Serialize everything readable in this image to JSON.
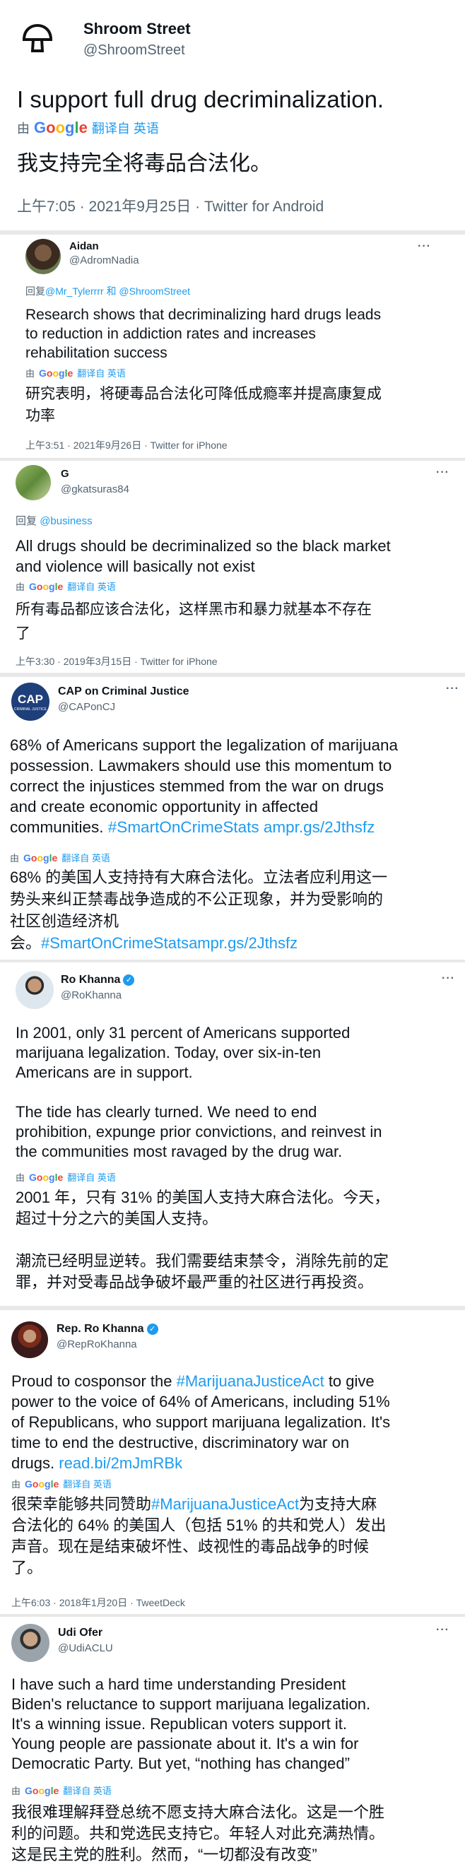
{
  "google": {
    "g1": "G",
    "o1": "o",
    "o2": "o",
    "g2": "g",
    "l": "l",
    "e": "e"
  },
  "t1": {
    "name": "Shroom Street",
    "handle": "@ShroomStreet",
    "text": "I support full drug decriminalization.",
    "trans_prefix": "由",
    "trans_link": "翻译自 英语",
    "zh": "我支持完全将毒品合法化。",
    "meta": "上午7:05 · 2021年9月25日 · Twitter for Android"
  },
  "t2": {
    "name": "Aidan",
    "handle": "@AdromNadia",
    "reply_prefix": "回复",
    "reply_links": "@Mr_Tylerrrr 和 @ShroomStreet",
    "text": "Research shows that decriminalizing hard drugs leads\nto reduction in addiction rates and increases\nrehabilitation success",
    "trans_prefix": "由",
    "trans_link": "翻译自 英语",
    "zh": "研究表明，将硬毒品合法化可降低成瘾率并提高康复成\n功率",
    "meta": "上午3:51 · 2021年9月26日 · Twitter for iPhone"
  },
  "t3": {
    "name": "G",
    "handle": "@gkatsuras84",
    "reply_prefix": "回复",
    "reply_links": "@business",
    "text": "All drugs should be decriminalized so the black market\nand violence will basically not exist",
    "trans_prefix": "由",
    "trans_link": "翻译自 英语",
    "zh": "所有毒品都应该合法化，这样黑市和暴力就基本不存在\n了",
    "meta": "上午3:30 · 2019年3月15日 · Twitter for iPhone"
  },
  "t4": {
    "name": "CAP on Criminal Justice",
    "handle": "@CAPonCJ",
    "avatar_text": "CAP",
    "avatar_sub": "CRIMINAL JUSTICE",
    "text": "68% of Americans support the legalization of marijuana\npossession. Lawmakers should use this momentum to\ncorrect the injustices stemmed from the war on drugs\nand create economic opportunity in affected\ncommunities. ",
    "text_link": "#SmartOnCrimeStats ampr.gs/2Jthsfz",
    "trans_prefix": "由",
    "trans_link": "翻译自 英语",
    "zh": "68% 的美国人支持持有大麻合法化。立法者应利用这一\n势头来纠正禁毒战争造成的不公正现象，并为受影响的\n社区创造经济机\n会。",
    "zh_link": "#SmartOnCrimeStatsampr.gs/2Jthsfz"
  },
  "t5": {
    "name": "Ro Khanna",
    "handle": "@RoKhanna",
    "text": "In 2001, only 31 percent of Americans supported\nmarijuana legalization. Today, over six-in-ten\nAmericans are in support.\n\nThe tide has clearly turned. We need to end\nprohibition, expunge prior convictions, and reinvest in\nthe communities most ravaged by the drug war.",
    "trans_prefix": "由",
    "trans_link": "翻译自 英语",
    "zh": "2001 年，只有 31% 的美国人支持大麻合法化。今天，\n超过十分之六的美国人支持。\n\n潮流已经明显逆转。我们需要结束禁令，消除先前的定\n罪，并对受毒品战争破坏最严重的社区进行再投资。"
  },
  "t6": {
    "name": "Rep. Ro Khanna",
    "handle": "@RepRoKhanna",
    "text_a": "Proud to cosponsor the ",
    "text_link1": "#MarijuanaJusticeAct",
    "text_b": " to give\npower to the voice of 64% of Americans, including 51%\nof Republicans, who support marijuana legalization. It's\ntime to end the destructive, discriminatory war on\ndrugs. ",
    "text_link2": "read.bi/2mJmRBk",
    "trans_prefix": "由",
    "trans_link": "翻译自 英语",
    "zh_a": "很荣幸能够共同赞助",
    "zh_link": "#MarijuanaJusticeAct",
    "zh_b": "为支持大麻\n合法化的 64% 的美国人（包括 51% 的共和党人）发出\n声音。现在是结束破坏性、歧视性的毒品战争的时候\n了。",
    "meta": "上午6:03 · 2018年1月20日 · TweetDeck"
  },
  "t7": {
    "name": "Udi Ofer",
    "handle": "@UdiACLU",
    "text": "I have such a hard time understanding President\nBiden's reluctance to support marijuana legalization.\nIt's a winning  issue. Republican voters support it.\nYoung people are passionate about it. It's a win for\nDemocratic Party. But yet, “nothing has changed”",
    "trans_prefix": "由",
    "trans_link": "翻译自 英语",
    "zh": "我很难理解拜登总统不愿支持大麻合法化。这是一个胜\n利的问题。共和党选民支持它。年轻人对此充满热情。\n这是民主党的胜利。然而，“一切都没有改变”"
  },
  "more_label": "···",
  "verified_mark": "✓",
  "colors": {
    "blue": "#1d9bf0",
    "gray": "#536471",
    "text": "#0f1419"
  }
}
